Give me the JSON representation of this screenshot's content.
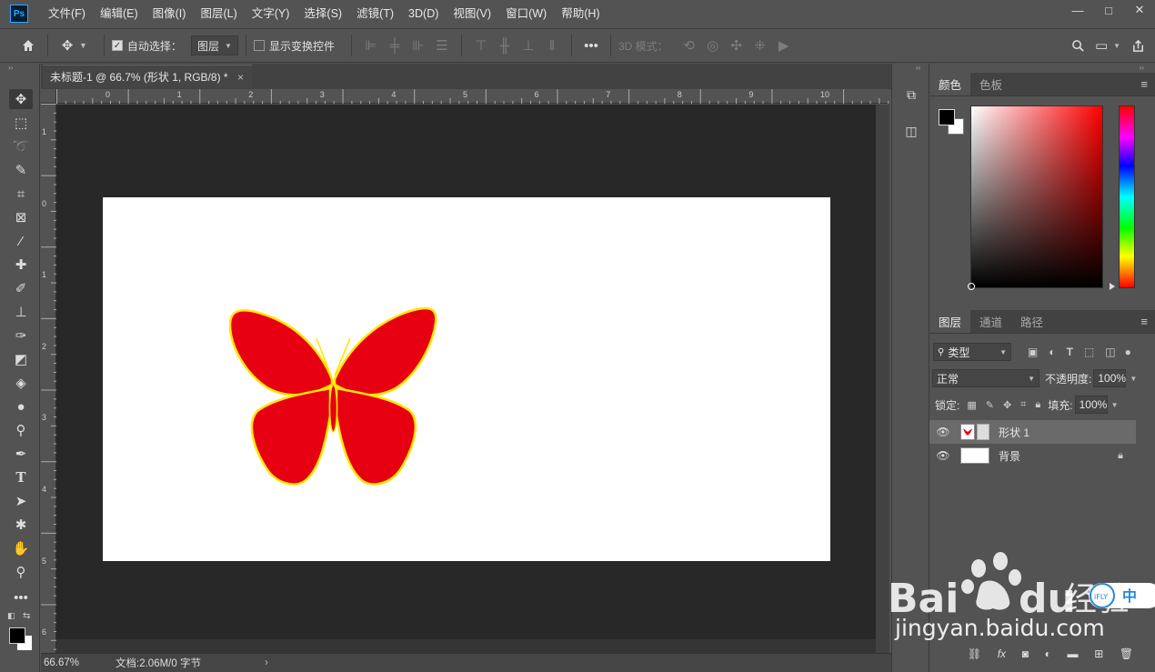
{
  "app": {
    "logo": "Ps",
    "menu": [
      "文件(F)",
      "编辑(E)",
      "图像(I)",
      "图层(L)",
      "文字(Y)",
      "选择(S)",
      "滤镜(T)",
      "3D(D)",
      "视图(V)",
      "窗口(W)",
      "帮助(H)"
    ],
    "window_controls": [
      "—",
      "□",
      "✕"
    ]
  },
  "options": {
    "auto_select_label": "自动选择：",
    "auto_select_checked": true,
    "auto_select_target": "图层",
    "show_transform_label": "显示变换控件",
    "more": "•••",
    "mode_3d_label": "3D 模式："
  },
  "document": {
    "tab_title": "未标题-1 @ 66.7% (形状 1, RGB/8) *",
    "tab_close": "×",
    "ruler_h_labels": [
      "0",
      "1",
      "2",
      "3",
      "4",
      "5",
      "6",
      "7",
      "8",
      "9",
      "10"
    ],
    "ruler_v_labels": [
      "1",
      "0",
      "1",
      "2",
      "3",
      "4",
      "5",
      "6"
    ],
    "zoom": "66.67%",
    "doc_info": "文档:2.06M/0 字节",
    "fill_color": "#e60012",
    "stroke_color": "#ffe600"
  },
  "color_panel": {
    "tabs": [
      "颜色",
      "色板"
    ],
    "active_tab": 0,
    "menu_icon": "≡"
  },
  "layers_panel": {
    "tabs": [
      "图层",
      "通道",
      "路径"
    ],
    "filter_label": "类型",
    "blend_mode": "正常",
    "opacity_label": "不透明度:",
    "opacity": "100%",
    "lock_label": "锁定:",
    "fill_label": "填充:",
    "fill": "100%",
    "layers": [
      {
        "name": "形状 1",
        "selected": true,
        "locked": false
      },
      {
        "name": "背景",
        "selected": false,
        "locked": true
      }
    ],
    "bottom_icons": [
      "link-icon",
      "fx-icon",
      "mask-icon",
      "adjustment-icon",
      "folder-icon",
      "new-layer-icon",
      "trash-icon"
    ],
    "fx_label": "fx"
  },
  "watermark": {
    "brand": "Bai du 经验",
    "url": "jingyan.baidu.com",
    "badge": "中"
  }
}
